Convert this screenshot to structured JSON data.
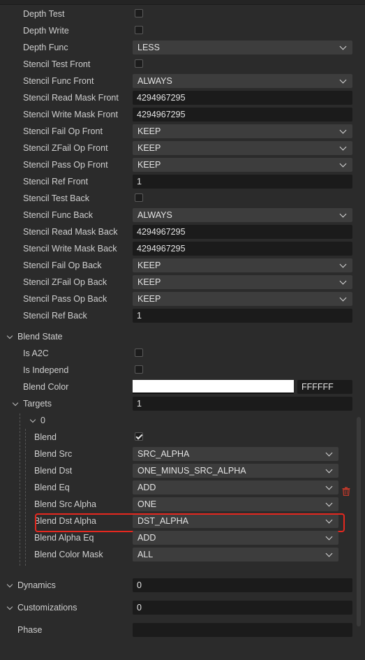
{
  "depth": {
    "depth_test": {
      "label": "Depth Test",
      "checked": false
    },
    "depth_write": {
      "label": "Depth Write",
      "checked": false
    },
    "depth_func": {
      "label": "Depth Func",
      "value": "LESS"
    }
  },
  "stencil": {
    "test_front": {
      "label": "Stencil Test Front",
      "checked": false
    },
    "func_front": {
      "label": "Stencil Func Front",
      "value": "ALWAYS"
    },
    "read_mask_front": {
      "label": "Stencil Read Mask Front",
      "value": "4294967295"
    },
    "write_mask_front": {
      "label": "Stencil Write Mask Front",
      "value": "4294967295"
    },
    "fail_op_front": {
      "label": "Stencil Fail Op Front",
      "value": "KEEP"
    },
    "zfail_op_front": {
      "label": "Stencil ZFail Op Front",
      "value": "KEEP"
    },
    "pass_op_front": {
      "label": "Stencil Pass Op Front",
      "value": "KEEP"
    },
    "ref_front": {
      "label": "Stencil Ref Front",
      "value": "1"
    },
    "test_back": {
      "label": "Stencil Test Back",
      "checked": false
    },
    "func_back": {
      "label": "Stencil Func Back",
      "value": "ALWAYS"
    },
    "read_mask_back": {
      "label": "Stencil Read Mask Back",
      "value": "4294967295"
    },
    "write_mask_back": {
      "label": "Stencil Write Mask Back",
      "value": "4294967295"
    },
    "fail_op_back": {
      "label": "Stencil Fail Op Back",
      "value": "KEEP"
    },
    "zfail_op_back": {
      "label": "Stencil ZFail Op Back",
      "value": "KEEP"
    },
    "pass_op_back": {
      "label": "Stencil Pass Op Back",
      "value": "KEEP"
    },
    "ref_back": {
      "label": "Stencil Ref Back",
      "value": "1"
    }
  },
  "blend_state": {
    "label": "Blend State",
    "is_a2c": {
      "label": "Is A2C",
      "checked": false
    },
    "is_independ": {
      "label": "Is Independ",
      "checked": false
    },
    "blend_color": {
      "label": "Blend Color",
      "hex": "FFFFFF",
      "color": "#ffffff"
    },
    "targets": {
      "label": "Targets",
      "value": "1"
    },
    "target0": {
      "label": "0",
      "blend": {
        "label": "Blend",
        "checked": true
      },
      "blend_src": {
        "label": "Blend Src",
        "value": "SRC_ALPHA"
      },
      "blend_dst": {
        "label": "Blend Dst",
        "value": "ONE_MINUS_SRC_ALPHA"
      },
      "blend_eq": {
        "label": "Blend Eq",
        "value": "ADD"
      },
      "blend_src_alpha": {
        "label": "Blend Src Alpha",
        "value": "ONE"
      },
      "blend_dst_alpha": {
        "label": "Blend Dst Alpha",
        "value": "DST_ALPHA"
      },
      "blend_alpha_eq": {
        "label": "Blend Alpha Eq",
        "value": "ADD"
      },
      "blend_color_mask": {
        "label": "Blend Color Mask",
        "value": "ALL"
      }
    }
  },
  "dynamics": {
    "label": "Dynamics",
    "value": "0"
  },
  "customizations": {
    "label": "Customizations",
    "value": "0"
  },
  "phase": {
    "label": "Phase",
    "value": ""
  },
  "colors": {
    "highlight": "#e5281f",
    "delete_icon": "#c0392b",
    "background": "#2b2b2b"
  },
  "icons": {
    "delete": "trash-icon",
    "dropdown": "chevron-down-icon",
    "tree_toggle": "chevron-down-icon"
  }
}
